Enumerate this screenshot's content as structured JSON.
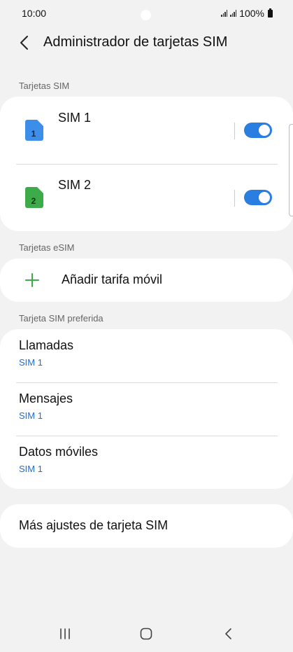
{
  "status": {
    "time": "10:00",
    "battery": "100%"
  },
  "header": {
    "title": "Administrador de tarjetas SIM"
  },
  "sections": {
    "sim_cards": "Tarjetas SIM",
    "esim": "Tarjetas eSIM",
    "preferred": "Tarjeta SIM preferida"
  },
  "sims": [
    {
      "name": "SIM 1",
      "badge": "1",
      "enabled": true,
      "color": "#3d8ee8"
    },
    {
      "name": "SIM 2",
      "badge": "2",
      "enabled": true,
      "color": "#3dab4a"
    }
  ],
  "esim": {
    "add_label": "Añadir tarifa móvil"
  },
  "preferred": [
    {
      "title": "Llamadas",
      "value": "SIM 1"
    },
    {
      "title": "Mensajes",
      "value": "SIM 1"
    },
    {
      "title": "Datos móviles",
      "value": "SIM 1"
    }
  ],
  "more": {
    "label": "Más ajustes de tarjeta SIM"
  },
  "colors": {
    "accent": "#2a7de1",
    "link": "#1f6fd1"
  }
}
